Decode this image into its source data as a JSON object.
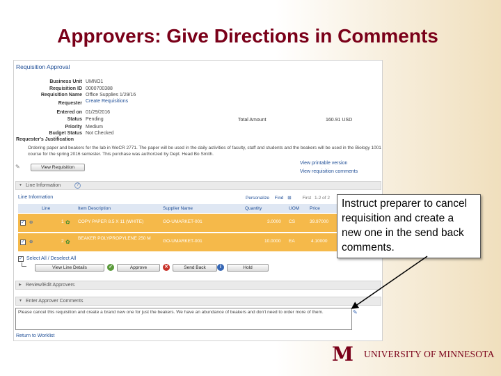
{
  "slide": {
    "title": "Approvers: Give Directions in Comments"
  },
  "screen": {
    "page_title": "Requisition Approval",
    "fields": [
      {
        "label": "Business Unit",
        "value": "UMNO1"
      },
      {
        "label": "Requisition ID",
        "value": "0000700388"
      },
      {
        "label": "Requisition Name",
        "value": "Office Supplies 1/29/16"
      },
      {
        "label": "Requester",
        "value": "Create Requisitions"
      },
      {
        "label": "Entered on",
        "value": "01/29/2016"
      },
      {
        "label": "Status",
        "value": "Pending"
      },
      {
        "label": "Priority",
        "value": "Medium"
      },
      {
        "label": "Budget Status",
        "value": "Not Checked"
      }
    ],
    "total_label": "Total Amount",
    "total_value": "160.91 USD",
    "justification_label": "Requester's Justification",
    "justification_text": "Ordering paper and beakers for the lab in WeCR 2771. The paper will be used in the daily activities of faculty, staff and students and the beakers will be used in the Biology 1001 course for the spring 2016 semester. This purchase was authorized by Dept. Head Bo Smith.",
    "view_requisition_button": "View Requisition",
    "view_printable_link": "View printable version",
    "view_approval_comments_link": "View requisition comments",
    "line_info_section": "Line Information",
    "line_info_header": "Line Information",
    "grid_tools": {
      "personalize": "Personalize",
      "find": "Find",
      "first": "First",
      "range": "1-2 of 2"
    },
    "columns": [
      "Line",
      "Item Description",
      "Supplier Name",
      "Quantity",
      "UOM",
      "Price"
    ],
    "rows": [
      {
        "line": "1",
        "item": "COPY PAPER 8.5 X 11 (WHITE)",
        "supplier": "GO-UMARKET-001",
        "qty": "3.0000",
        "uom": "CS",
        "price": "39.97000"
      },
      {
        "line": "2",
        "item": "BEAKER POLYPROPYLENE 250 M",
        "supplier": "GO-UMARKET-001",
        "qty": "10.0000",
        "uom": "EA",
        "price": "4.10000"
      }
    ],
    "select_all": "Select All / Deselect All",
    "buttons": {
      "view_line_details": "View Line Details",
      "approve": "Approve",
      "send_back": "Send Back",
      "hold": "Hold"
    },
    "review_section": "Review/Edit Approvers",
    "comments_section": "Enter Approver Comments",
    "comment_text": "Please cancel this requisition and create a brand new one for just the beakers. We have an abundance of beakers and don't need to order more of them.",
    "return_link": "Return to Worklist"
  },
  "callout": {
    "text": "Instruct preparer to cancel requisition and create a new one in the send back comments."
  },
  "footer": {
    "logo_mark": "M",
    "logo_text": "UNIVERSITY OF MINNESOTA"
  },
  "colors": {
    "maroon": "#7a0019",
    "gold_row": "#f5b94a",
    "link_blue": "#1f4e96"
  }
}
